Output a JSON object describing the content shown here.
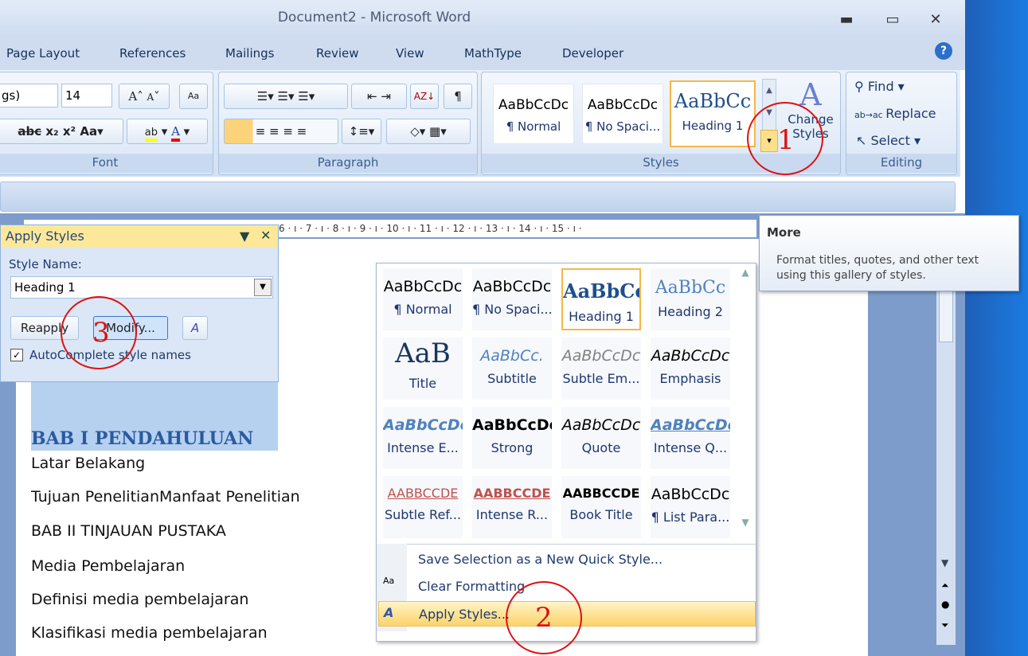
{
  "window": {
    "title": "Document2 - Microsoft Word",
    "minimize": "▬",
    "maximize": "▭",
    "close": "✕"
  },
  "tabs": [
    "Page Layout",
    "References",
    "Mailings",
    "Review",
    "View",
    "MathType",
    "Developer"
  ],
  "help": "?",
  "font": {
    "name": "gs)",
    "size": "14",
    "group_label": "Font",
    "grow": "A",
    "shrink": "A",
    "clear": "Aa",
    "strike": "abc",
    "subscript": "x₂",
    "superscript": "x²",
    "case": "Aa",
    "highlight": "ab",
    "color": "A",
    "highlight_color": "#ffff00",
    "font_color": "#e00000"
  },
  "paragraph": {
    "group_label": "Paragraph"
  },
  "styles": {
    "group_label": "Styles",
    "items": [
      {
        "sample": "AaBbCcDc",
        "name": "¶ Normal"
      },
      {
        "sample": "AaBbCcDc",
        "name": "¶ No Spaci..."
      },
      {
        "sample": "AaBbCc",
        "name": "Heading 1"
      }
    ],
    "change_styles": "Change Styles"
  },
  "editing": {
    "group_label": "Editing",
    "find": "Find",
    "replace": "Replace",
    "select": "Select"
  },
  "ruler": "6 · ı · 7 · ı · 8 · ı · 9 · ı · 10 · ı · 11 · ı · 12 · ı · 13 · ı · 14 · ı · 15 · ı ·",
  "apply_styles": {
    "title": "Apply Styles",
    "style_name_label": "Style Name:",
    "style_name_value": "Heading 1",
    "reapply": "Reapply",
    "modify": "Modify...",
    "autocomplete": "AutoComplete style names",
    "autocomplete_checked": true
  },
  "document": {
    "lines": [
      "BAB I PENDAHULUAN",
      "Latar Belakang",
      "Tujuan PenelitianManfaat Penelitian",
      "BAB II TINJAUAN PUSTAKA",
      "Media Pembelajaran",
      "Definisi media pembelajaran",
      "Klasifikasi media pembelajaran"
    ]
  },
  "gallery": {
    "items": [
      {
        "sample": "AaBbCcDc",
        "name": "¶ Normal"
      },
      {
        "sample": "AaBbCcDc",
        "name": "¶ No Spaci..."
      },
      {
        "sample": "AaBbCc",
        "name": "Heading 1"
      },
      {
        "sample": "AaBbCc",
        "name": "Heading 2"
      },
      {
        "sample": "AaB",
        "name": "Title"
      },
      {
        "sample": "AaBbCc.",
        "name": "Subtitle"
      },
      {
        "sample": "AaBbCcDc",
        "name": "Subtle Em..."
      },
      {
        "sample": "AaBbCcDc",
        "name": "Emphasis"
      },
      {
        "sample": "AaBbCcDc",
        "name": "Intense E..."
      },
      {
        "sample": "AaBbCcDc",
        "name": "Strong"
      },
      {
        "sample": "AaBbCcDc",
        "name": "Quote"
      },
      {
        "sample": "AaBbCcDc",
        "name": "Intense Q..."
      },
      {
        "sample": "AABBCCDE",
        "name": "Subtle Ref..."
      },
      {
        "sample": "AABBCCDE",
        "name": "Intense R..."
      },
      {
        "sample": "AABBCCDE",
        "name": "Book Title"
      },
      {
        "sample": "AaBbCcDc",
        "name": "¶ List Para..."
      }
    ],
    "menu": [
      "Save Selection as a New Quick Style...",
      "Clear Formatting",
      "Apply Styles..."
    ]
  },
  "tooltip": {
    "title": "More",
    "text": "Format titles, quotes, and other text using this gallery of styles."
  },
  "annotations": [
    "1",
    "2",
    "3"
  ]
}
